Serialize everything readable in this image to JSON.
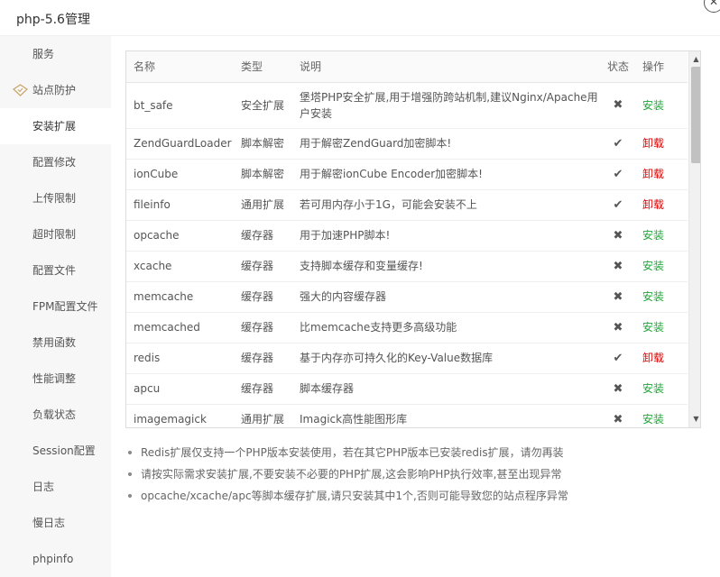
{
  "window": {
    "title": "php-5.6管理",
    "close_icon": "close-icon"
  },
  "sidebar": {
    "items": [
      {
        "label": "服务"
      },
      {
        "label": "站点防护",
        "icon": "shield-icon"
      },
      {
        "label": "安装扩展",
        "active": true
      },
      {
        "label": "配置修改"
      },
      {
        "label": "上传限制"
      },
      {
        "label": "超时限制"
      },
      {
        "label": "配置文件"
      },
      {
        "label": "FPM配置文件"
      },
      {
        "label": "禁用函数"
      },
      {
        "label": "性能调整"
      },
      {
        "label": "负载状态"
      },
      {
        "label": "Session配置"
      },
      {
        "label": "日志"
      },
      {
        "label": "慢日志"
      },
      {
        "label": "phpinfo"
      }
    ]
  },
  "table": {
    "headers": {
      "name": "名称",
      "type": "类型",
      "desc": "说明",
      "status": "状态",
      "op": "操作"
    },
    "rows": [
      {
        "name": "bt_safe",
        "type": "安全扩展",
        "desc": "堡塔PHP安全扩展,用于增强防跨站机制,建议Nginx/Apache用户安装",
        "status": "✖",
        "op": "安装"
      },
      {
        "name": "ZendGuardLoader",
        "type": "脚本解密",
        "desc": "用于解密ZendGuard加密脚本!",
        "status": "✔",
        "op": "卸载"
      },
      {
        "name": "ionCube",
        "type": "脚本解密",
        "desc": "用于解密ionCube Encoder加密脚本!",
        "status": "✔",
        "op": "卸载"
      },
      {
        "name": "fileinfo",
        "type": "通用扩展",
        "desc": "若可用内存小于1G，可能会安装不上",
        "status": "✔",
        "op": "卸载"
      },
      {
        "name": "opcache",
        "type": "缓存器",
        "desc": "用于加速PHP脚本!",
        "status": "✖",
        "op": "安装"
      },
      {
        "name": "xcache",
        "type": "缓存器",
        "desc": "支持脚本缓存和变量缓存!",
        "status": "✖",
        "op": "安装"
      },
      {
        "name": "memcache",
        "type": "缓存器",
        "desc": "强大的内容缓存器",
        "status": "✖",
        "op": "安装"
      },
      {
        "name": "memcached",
        "type": "缓存器",
        "desc": "比memcache支持更多高级功能",
        "status": "✖",
        "op": "安装"
      },
      {
        "name": "redis",
        "type": "缓存器",
        "desc": "基于内存亦可持久化的Key-Value数据库",
        "status": "✔",
        "op": "卸载"
      },
      {
        "name": "apcu",
        "type": "缓存器",
        "desc": "脚本缓存器",
        "status": "✖",
        "op": "安装"
      },
      {
        "name": "imagemagick",
        "type": "通用扩展",
        "desc": "Imagick高性能图形库",
        "status": "✖",
        "op": "安装"
      }
    ],
    "colors": {
      "install": "#20a53a",
      "uninstall": "#e00000"
    }
  },
  "notes": [
    "Redis扩展仅支持一个PHP版本安装使用，若在其它PHP版本已安装redis扩展，请勿再装",
    "请按实际需求安装扩展,不要安装不必要的PHP扩展,这会影响PHP执行效率,甚至出现异常",
    "opcache/xcache/apc等脚本缓存扩展,请只安装其中1个,否则可能导致您的站点程序异常"
  ]
}
